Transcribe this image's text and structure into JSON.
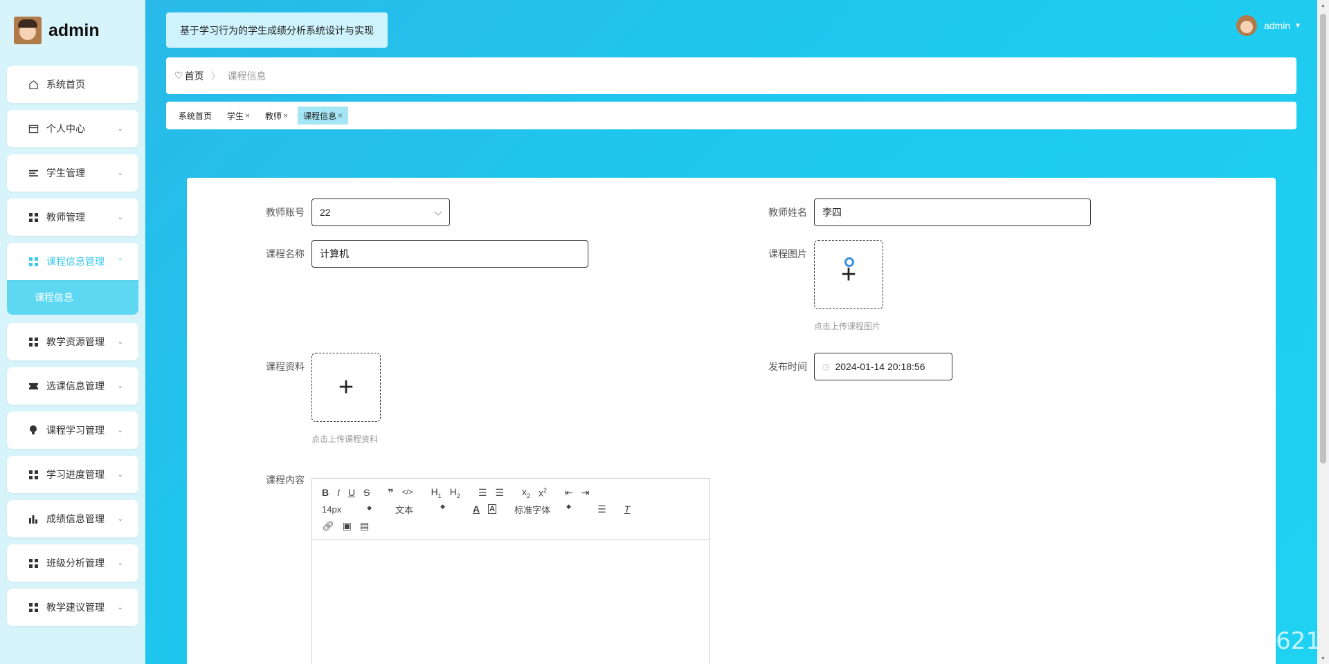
{
  "brand": {
    "name": "admin"
  },
  "sidebar": {
    "items": [
      {
        "label": "系统首页",
        "icon": "home-icon",
        "has_children": false
      },
      {
        "label": "个人中心",
        "icon": "card-icon",
        "has_children": true
      },
      {
        "label": "学生管理",
        "icon": "list-icon",
        "has_children": true
      },
      {
        "label": "教师管理",
        "icon": "grid-icon",
        "has_children": true
      },
      {
        "label": "课程信息管理",
        "icon": "grid-icon",
        "has_children": true,
        "expanded": true,
        "children": [
          {
            "label": "课程信息"
          }
        ]
      },
      {
        "label": "教学资源管理",
        "icon": "grid-icon",
        "has_children": true
      },
      {
        "label": "选课信息管理",
        "icon": "ticket-icon",
        "has_children": true
      },
      {
        "label": "课程学习管理",
        "icon": "bulb-icon",
        "has_children": true
      },
      {
        "label": "学习进度管理",
        "icon": "grid-icon",
        "has_children": true
      },
      {
        "label": "成绩信息管理",
        "icon": "bar-chart-icon",
        "has_children": true
      },
      {
        "label": "班级分析管理",
        "icon": "grid-icon",
        "has_children": true
      },
      {
        "label": "教学建议管理",
        "icon": "grid-icon",
        "has_children": true
      }
    ]
  },
  "header": {
    "system_title": "基于学习行为的学生成绩分析系统设计与实现",
    "user_name": "admin"
  },
  "breadcrumb": {
    "home": "首页",
    "separator": "〉",
    "current": "课程信息"
  },
  "tabs": [
    {
      "label": "系统首页",
      "closable": false
    },
    {
      "label": "学生",
      "closable": true
    },
    {
      "label": "教师",
      "closable": true
    },
    {
      "label": "课程信息",
      "closable": true,
      "active": true
    }
  ],
  "form": {
    "teacher_account": {
      "label": "教师账号",
      "value": "22"
    },
    "teacher_name": {
      "label": "教师姓名",
      "value": "李四"
    },
    "course_name": {
      "label": "课程名称",
      "value": "计算机"
    },
    "course_image": {
      "label": "课程图片",
      "hint": "点击上传课程图片"
    },
    "course_material": {
      "label": "课程资料",
      "hint": "点击上传课程资料"
    },
    "publish_time": {
      "label": "发布时间",
      "value": "2024-01-14 20:18:56"
    },
    "course_content": {
      "label": "课程内容"
    }
  },
  "editor": {
    "font_size": "14px",
    "text_type": "文本",
    "font_family": "标准字体"
  },
  "watermark": "CSDN @王老师621",
  "colors": {
    "accent": "#3fc8ea",
    "submenu_bg": "#5ed8f2",
    "tab_active": "#a4e5f6"
  }
}
